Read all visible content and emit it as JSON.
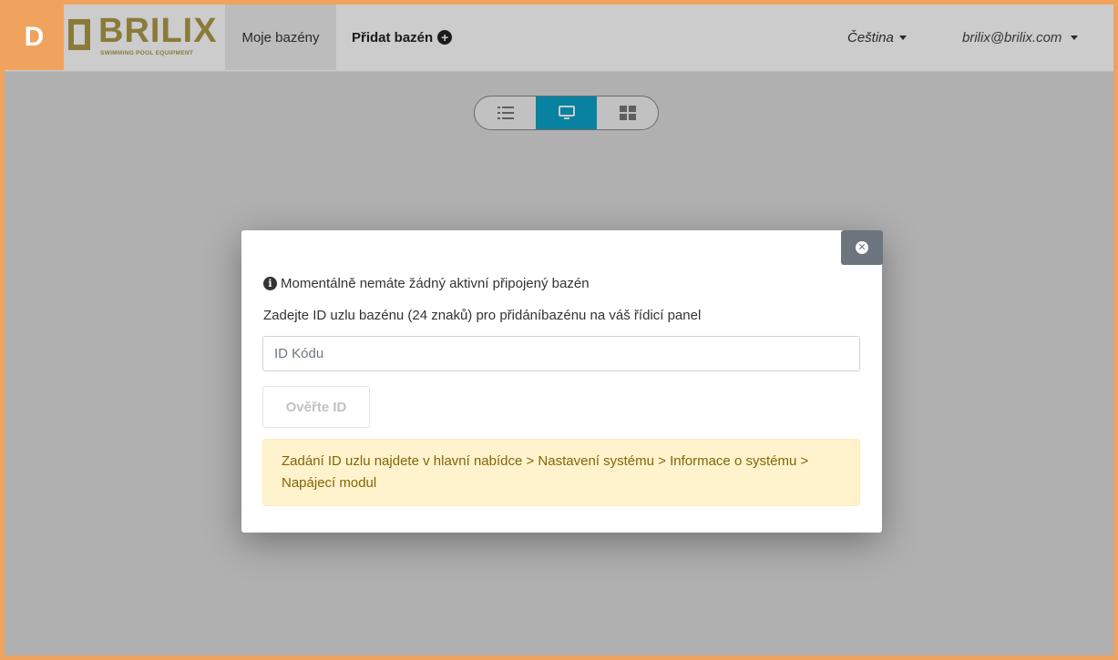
{
  "badge": "D",
  "brand": {
    "name": "BRILIX",
    "tagline": "SWIMMING POOL EQUIPMENT"
  },
  "nav": {
    "my_pools": "Moje bazény",
    "add_pool": "Přidat bazén",
    "language": "Čeština",
    "user": "brilix@brilix.com"
  },
  "view_toggle": {
    "options": [
      "list-icon",
      "monitor-icon",
      "grid-icon"
    ],
    "active": "monitor-icon"
  },
  "modal": {
    "message": "Momentálně nemáte žádný aktivní připojený bazén",
    "instruction": "Zadejte ID uzlu bazénu (24 znaků) pro přidáníbazénu na váš řídicí panel",
    "input_placeholder": "ID Kódu",
    "input_value": "",
    "verify_label": "Ověřte ID",
    "hint": "Zadání ID uzlu najdete v hlavní nabídce > Nastavení systému > Informace o systému > Napájecí modul"
  },
  "colors": {
    "accent_frame": "#f0a35e",
    "brand_gold": "#ad9a4a",
    "active_view": "#0aa3c9",
    "close_button": "#6c757d",
    "warning_bg": "#fff3cd",
    "warning_text": "#856404"
  }
}
